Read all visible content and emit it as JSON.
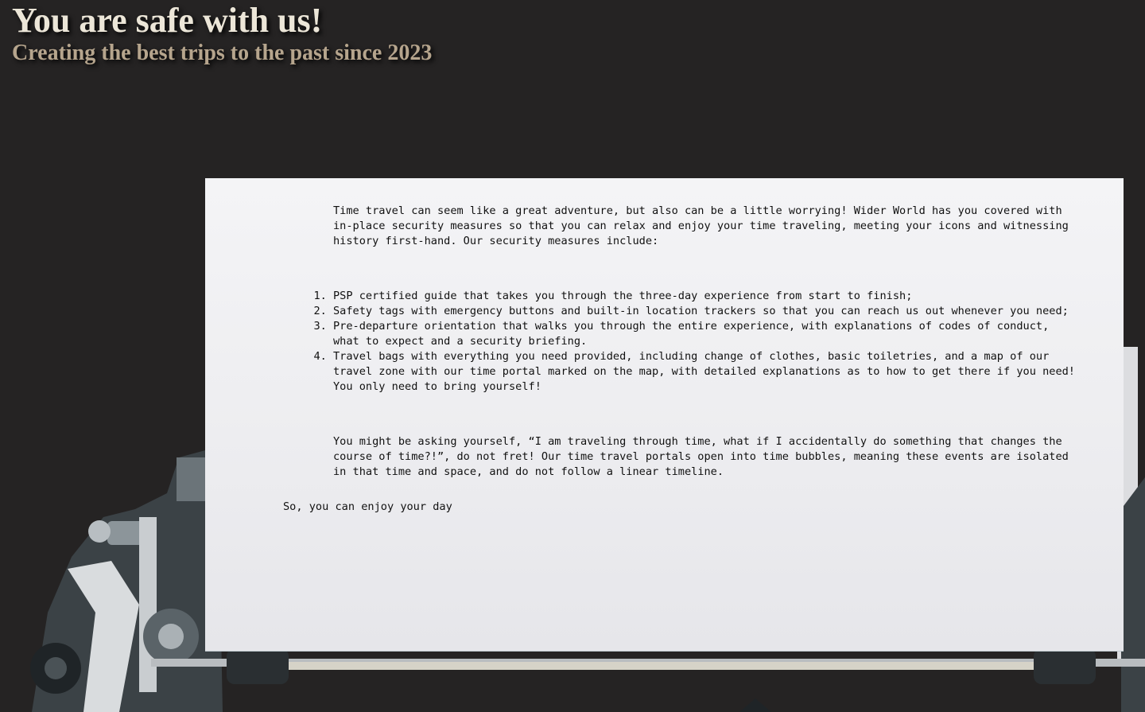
{
  "header": {
    "title": "You are safe with us!",
    "subtitle": "Creating the best trips to the past since 2023"
  },
  "paper": {
    "intro": "Time travel can seem like a great adventure, but also can be a little worrying! Wider World has you covered with in-place security measures so that you can relax and enjoy your time traveling, meeting your icons and witnessing history first-hand. Our security measures include:",
    "measures": [
      "PSP certified guide that takes you through the three-day experience from start to finish;",
      "Safety tags with emergency buttons and built-in location trackers so that you can reach us out whenever you need;",
      "Pre-departure orientation that walks you through the entire experience, with explanations of codes of conduct, what to expect and a security briefing.",
      "Travel bags with everything you need provided, including change of clothes, basic toiletries, and a map of our travel zone with our time portal marked on the map, with detailed explanations as to how to get there if you need! You only need to bring yourself!"
    ],
    "closing": "You might be asking yourself, “I am traveling through time, what if I accidentally do something that changes the course of time?!”, do not fret! Our time travel portals open into time bubbles, meaning these events are isolated in that time and space, and do not follow a linear timeline.",
    "signoff": "So, you can enjoy your day"
  },
  "colors": {
    "background": "#252323",
    "title": "#ece6d8",
    "subtitle": "#b6a58d",
    "paper": "#f0f0f2",
    "text": "#111111"
  }
}
